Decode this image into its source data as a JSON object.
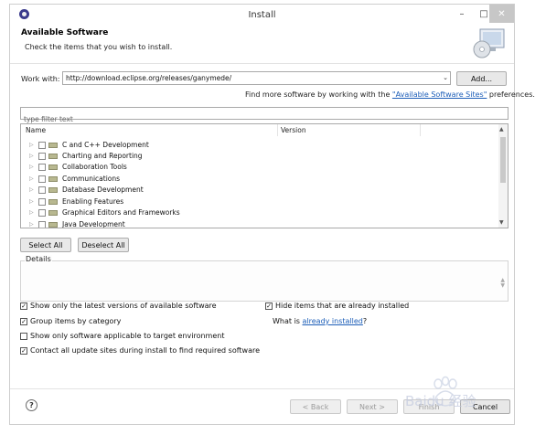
{
  "window": {
    "title": "Install",
    "minimize": "–",
    "maximize": "□",
    "close": "✕"
  },
  "header": {
    "title": "Available Software",
    "description": "Check the items that you wish to install."
  },
  "work_with": {
    "label": "Work with:",
    "value": "http://download.eclipse.org/releases/ganymede/",
    "dropdown_icon": "⌄",
    "add_button": "Add..."
  },
  "sites_hint": {
    "prefix": "Find more software by working with the ",
    "link": "\"Available Software Sites\"",
    "suffix": " preferences."
  },
  "filter": {
    "placeholder": "type filter text"
  },
  "tree": {
    "columns": [
      "Name",
      "Version"
    ],
    "items": [
      {
        "label": "C and C++ Development"
      },
      {
        "label": "Charting and Reporting"
      },
      {
        "label": "Collaboration Tools"
      },
      {
        "label": "Communications"
      },
      {
        "label": "Database Development"
      },
      {
        "label": "Enabling Features"
      },
      {
        "label": "Graphical Editors and Frameworks"
      },
      {
        "label": "Java Development"
      }
    ]
  },
  "selection_buttons": {
    "select_all": "Select All",
    "deselect_all": "Deselect All"
  },
  "details": {
    "label": "Details"
  },
  "options": {
    "latest_versions": "Show only the latest versions of available software",
    "group_by_category": "Group items by category",
    "target_env": "Show only software applicable to target environment",
    "contact_sites": "Contact all update sites during install to find required software",
    "hide_installed": "Hide items that are already installed",
    "what_is_prefix": "What is ",
    "what_is_link": "already installed",
    "what_is_suffix": "?"
  },
  "footer": {
    "help": "?",
    "back": "< Back",
    "next": "Next >",
    "finish": "Finish",
    "cancel": "Cancel"
  },
  "watermark": {
    "text": "Baidu 经验"
  }
}
